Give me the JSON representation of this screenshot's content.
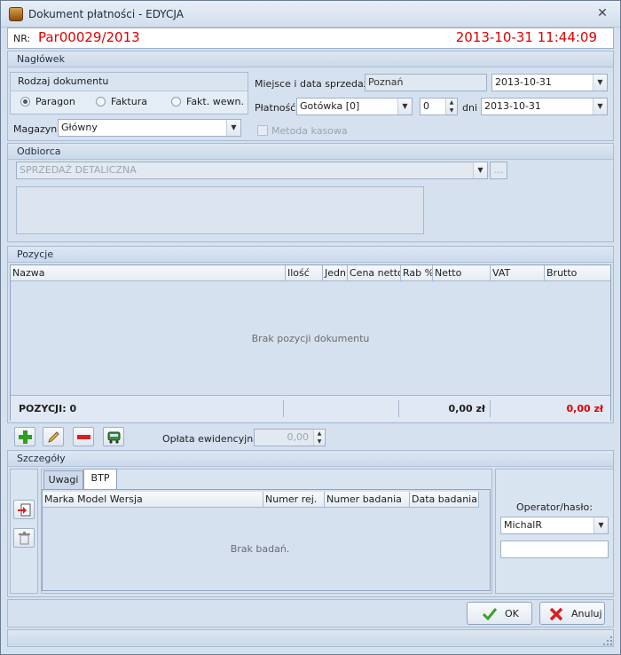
{
  "window": {
    "title": "Dokument płatności - EDYCJA",
    "close_glyph": "✕"
  },
  "nr": {
    "label": "NR:",
    "value": "Par00029/2013",
    "datetime": "2013-10-31 11:44:09"
  },
  "naglowek": {
    "title": "Nagłówek",
    "rodzaj": {
      "title": "Rodzaj dokumentu",
      "options": [
        "Paragon",
        "Faktura",
        "Fakt. wewn."
      ],
      "selected": "Paragon"
    },
    "magazyn": {
      "label": "Magazyn:",
      "value": "Główny"
    },
    "miejsce": {
      "label": "Miejsce i data sprzedaży:",
      "place": "Poznań",
      "date": "2013-10-31"
    },
    "platnosc": {
      "label": "Płatność:",
      "value": "Gotówka [0]",
      "days": "0",
      "days_label": "dni",
      "due_date": "2013-10-31"
    },
    "metoda_kasowa": {
      "label": "Metoda kasowa",
      "checked": false
    }
  },
  "odbiorca": {
    "title": "Odbiorca",
    "value": "SPRZEDAŻ DETALICZNA",
    "browse": "..."
  },
  "pozycje": {
    "title": "Pozycje",
    "columns": [
      "Nazwa",
      "Ilość",
      "Jedn",
      "Cena netto",
      "Rab %",
      "Netto",
      "VAT",
      "Brutto"
    ],
    "empty": "Brak pozycji dokumentu",
    "summary_count": "POZYCJI: 0",
    "summary_netto": "0,00 zł",
    "summary_brutto": "0,00 zł",
    "brutto_color": "#e00000"
  },
  "toolbar": {
    "icons": [
      "add-icon",
      "edit-icon",
      "remove-icon",
      "vehicle-icon"
    ],
    "oplata_label": "Opłata ewidencyjna:",
    "oplata_value": "0,00"
  },
  "szczegoly": {
    "title": "Szczegóły",
    "tabs": [
      "Uwagi",
      "BTP"
    ],
    "active_tab": "BTP",
    "columns": [
      "Marka Model Wersja",
      "Numer rej.",
      "Numer badania",
      "Data badania"
    ],
    "empty": "Brak badań.",
    "operator_label": "Operator/hasło:",
    "operator_value": "MichalR",
    "password_value": ""
  },
  "buttons": {
    "ok": "OK",
    "cancel": "Anuluj"
  },
  "colors": {
    "accent_red": "#e00000",
    "panel_bg": "#d5e1ef",
    "ok_green": "#3aa12a",
    "cancel_red": "#d62020"
  }
}
